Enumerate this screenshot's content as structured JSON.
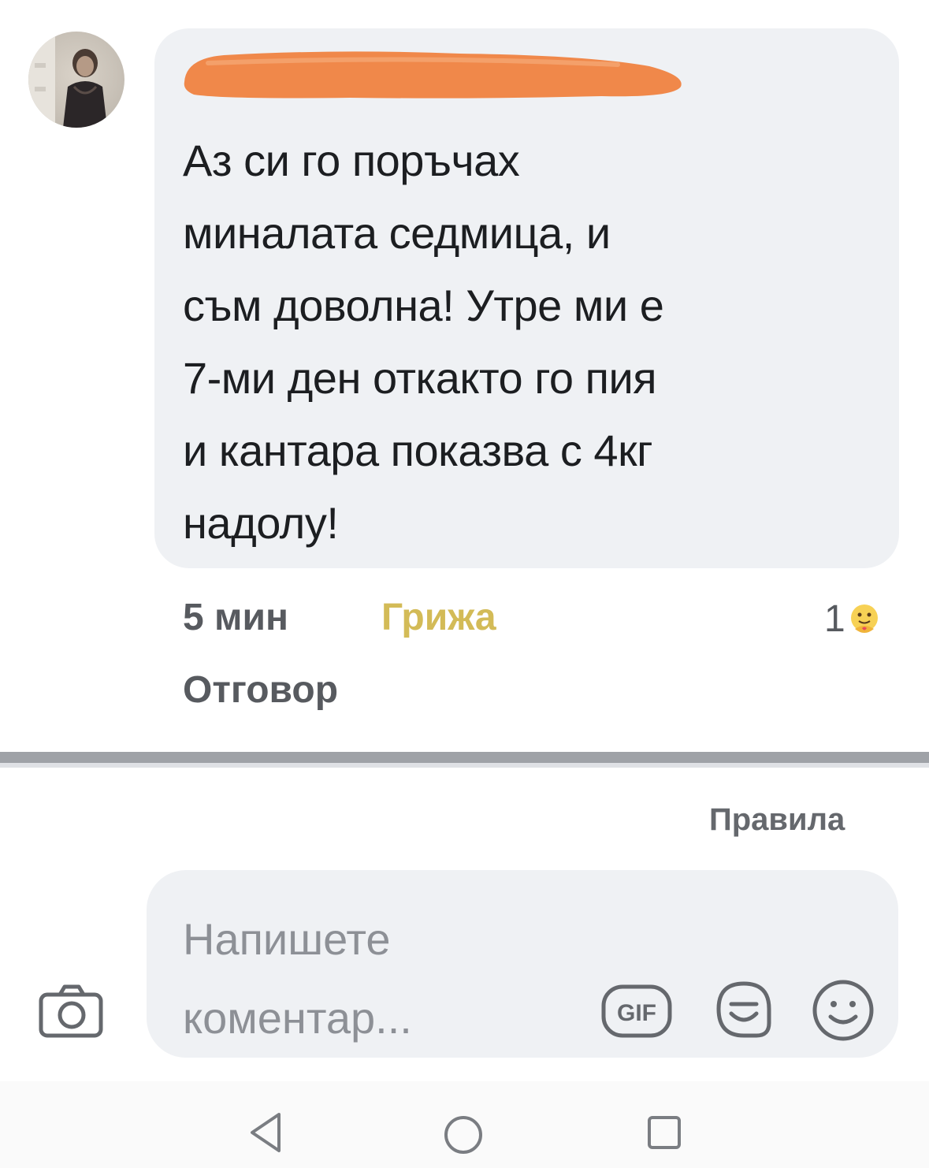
{
  "comment": {
    "text_lines": [
      "Аз си го поръчах",
      "миналата седмица, и",
      "съм доволна!  Утре ми е",
      "7-ми ден откакто го пия",
      "и кантара показва с 4кг",
      "надолу!"
    ],
    "time": "5 мин",
    "reaction_label": "Грижа",
    "reaction_count": "1",
    "reaction_icon": "care-emoji-icon",
    "reply_label": "Отговор"
  },
  "composer": {
    "rules_label": "Правила",
    "placeholder_lines": [
      "Напишете",
      "коментар..."
    ],
    "gif_label": "GIF"
  },
  "colors": {
    "bubble": "#eff1f4",
    "text": "#1c1e21",
    "meta": "#575a5f",
    "care": "#d3bb57",
    "redaction": "#f0884a"
  }
}
